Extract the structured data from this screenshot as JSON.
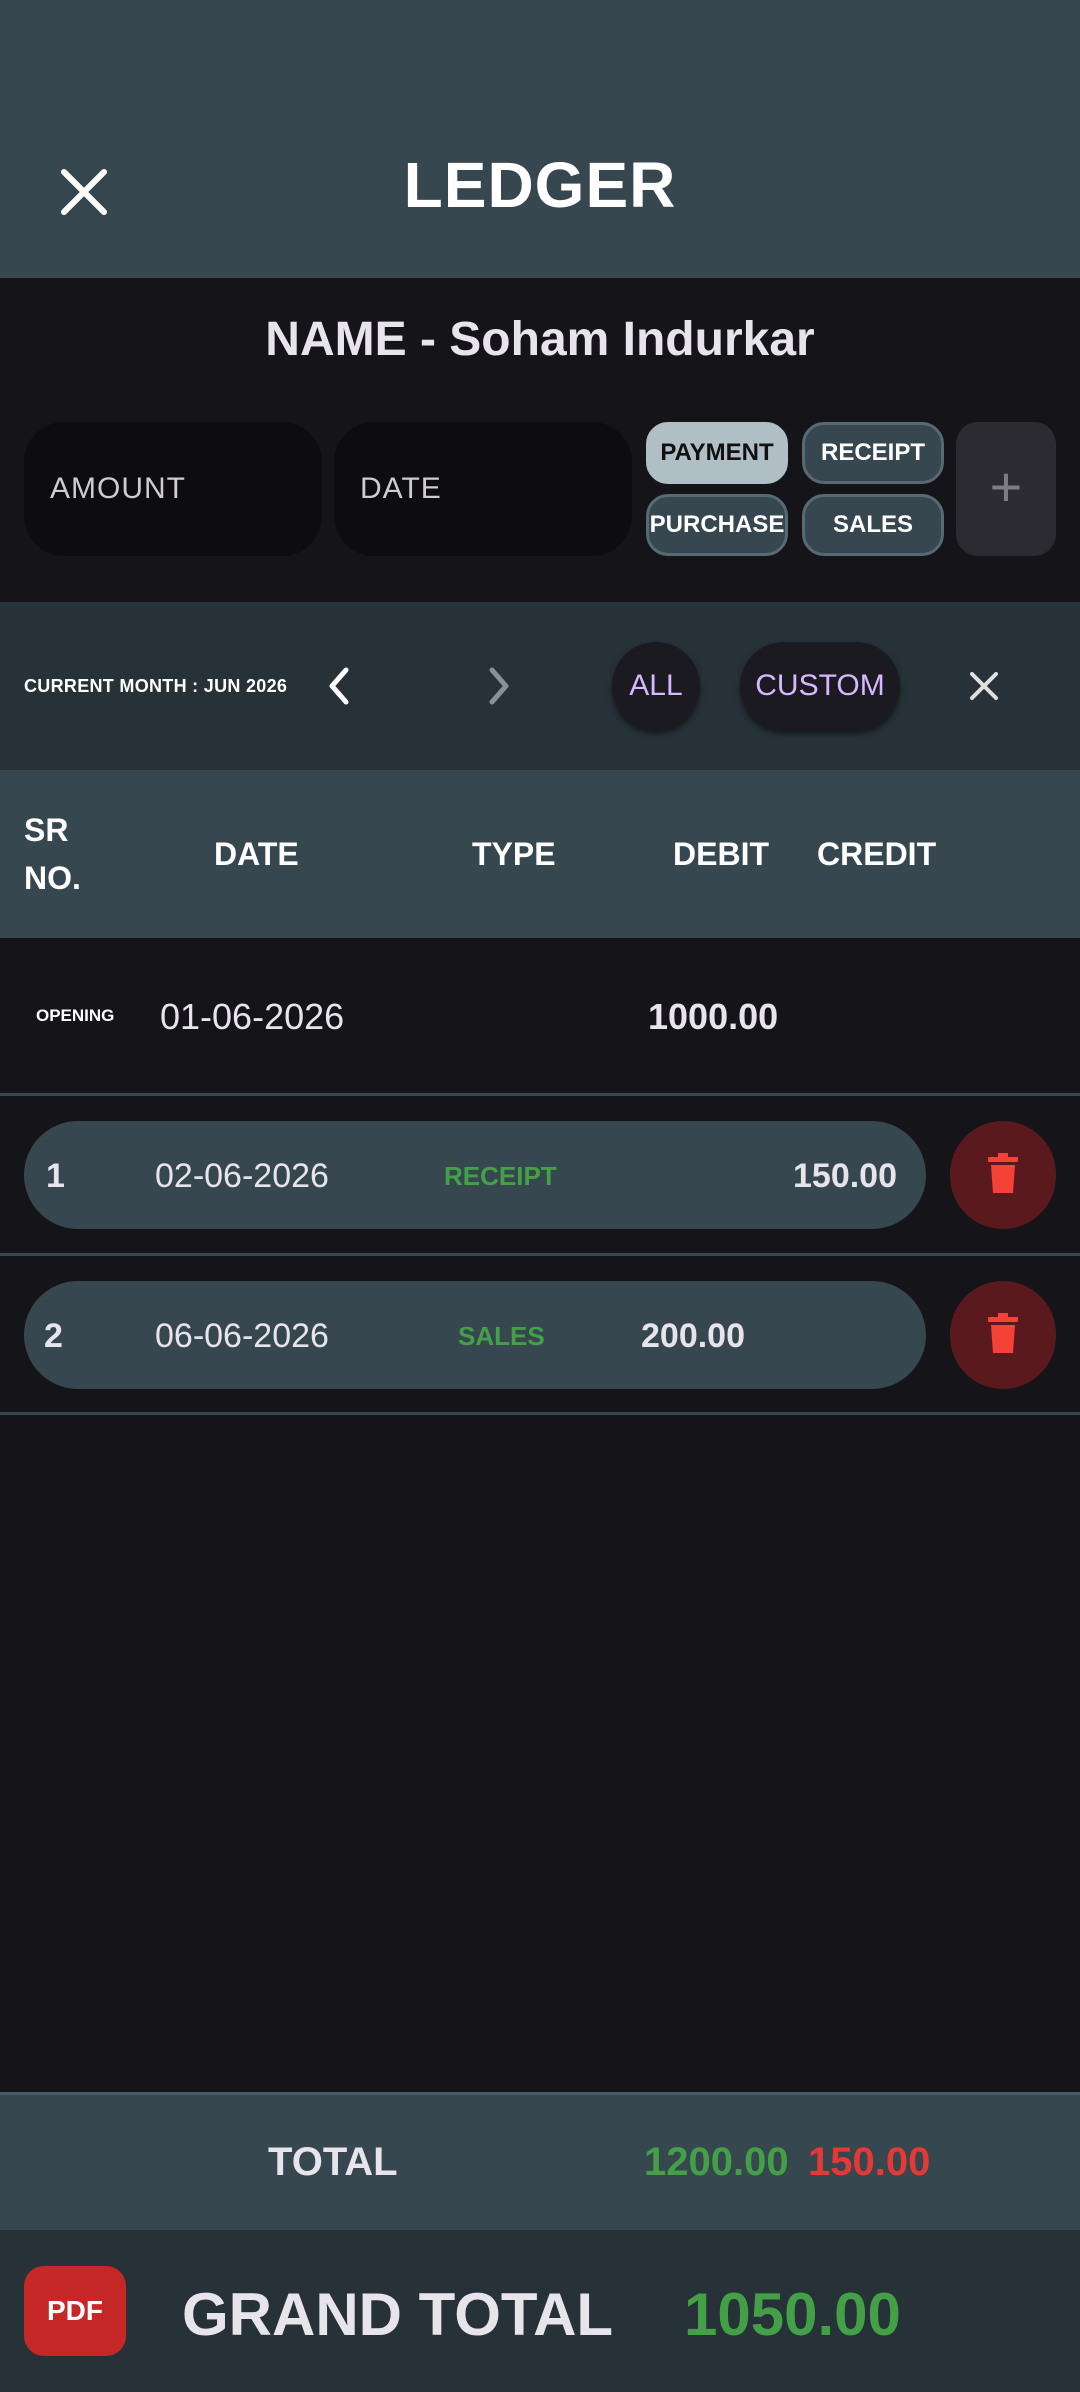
{
  "appbar": {
    "title": "LEDGER",
    "close_icon": "close-icon"
  },
  "party": {
    "name_line": "NAME - Soham Indurkar"
  },
  "entry_form": {
    "amount_placeholder": "AMOUNT",
    "date_placeholder": "DATE",
    "type_chips": [
      {
        "label": "PAYMENT",
        "selected": true
      },
      {
        "label": "RECEIPT",
        "selected": false
      },
      {
        "label": "PURCHASE",
        "selected": false
      },
      {
        "label": "SALES",
        "selected": false
      }
    ],
    "add_label": "+"
  },
  "filter": {
    "current_month": "CURRENT MONTH : JUN 2026",
    "all_label": "ALL",
    "custom_label": "CUSTOM"
  },
  "table": {
    "headers": {
      "sr_line1": "SR",
      "sr_line2": "NO.",
      "date": "DATE",
      "type": "TYPE",
      "debit": "DEBIT",
      "credit": "CREDIT"
    },
    "opening": {
      "label": "OPENING",
      "date": "01-06-2026",
      "debit": "1000.00"
    },
    "rows": [
      {
        "sr": "1",
        "date": "02-06-2026",
        "type": "RECEIPT",
        "debit": "",
        "credit": "150.00"
      },
      {
        "sr": "2",
        "date": "06-06-2026",
        "type": "SALES",
        "debit": "200.00",
        "credit": ""
      }
    ]
  },
  "totals": {
    "label": "TOTAL",
    "debit": "1200.00",
    "credit": "150.00"
  },
  "grand_total": {
    "pdf_label": "PDF",
    "label": "GRAND TOTAL",
    "value": "1050.00"
  },
  "colors": {
    "appbar": "#37474f",
    "background": "#151419",
    "positive": "#43a047",
    "negative": "#e53935",
    "accent": "#d5b8ff",
    "delete": "#5a1a1d"
  }
}
